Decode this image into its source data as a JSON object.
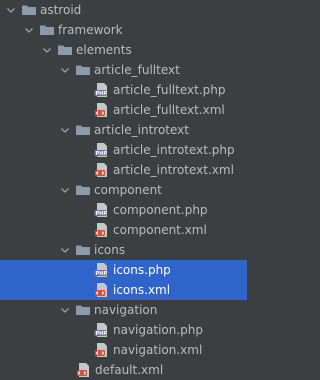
{
  "tree": {
    "root": {
      "label": "astroid",
      "icon": "folder-icon"
    },
    "framework": {
      "label": "framework",
      "icon": "folder-icon"
    },
    "elements": {
      "label": "elements",
      "icon": "folder-icon"
    },
    "article_fulltext": {
      "label": "article_fulltext",
      "files": [
        "article_fulltext.php",
        "article_fulltext.xml"
      ]
    },
    "article_introtext": {
      "label": "article_introtext",
      "files": [
        "article_introtext.php",
        "article_introtext.xml"
      ]
    },
    "component": {
      "label": "component",
      "files": [
        "component.php",
        "component.xml"
      ]
    },
    "icons": {
      "label": "icons",
      "files": [
        "icons.php",
        "icons.xml"
      ]
    },
    "navigation": {
      "label": "navigation",
      "files": [
        "navigation.php",
        "navigation.xml"
      ]
    },
    "default_file": "default.xml",
    "selected_files": [
      "icons.php",
      "icons.xml"
    ]
  },
  "colors": {
    "background": "#3c3f41",
    "selection": "#2f65ca",
    "text": "#bbbbbb",
    "folder": "#8a9bac",
    "php_badge": "#6d6db3",
    "xml_badge": "#d0503a"
  },
  "icons": {
    "chevron": "chevron-down-icon",
    "folder": "folder-icon",
    "php_file": "php-file-icon",
    "xml_file": "xml-file-icon"
  }
}
